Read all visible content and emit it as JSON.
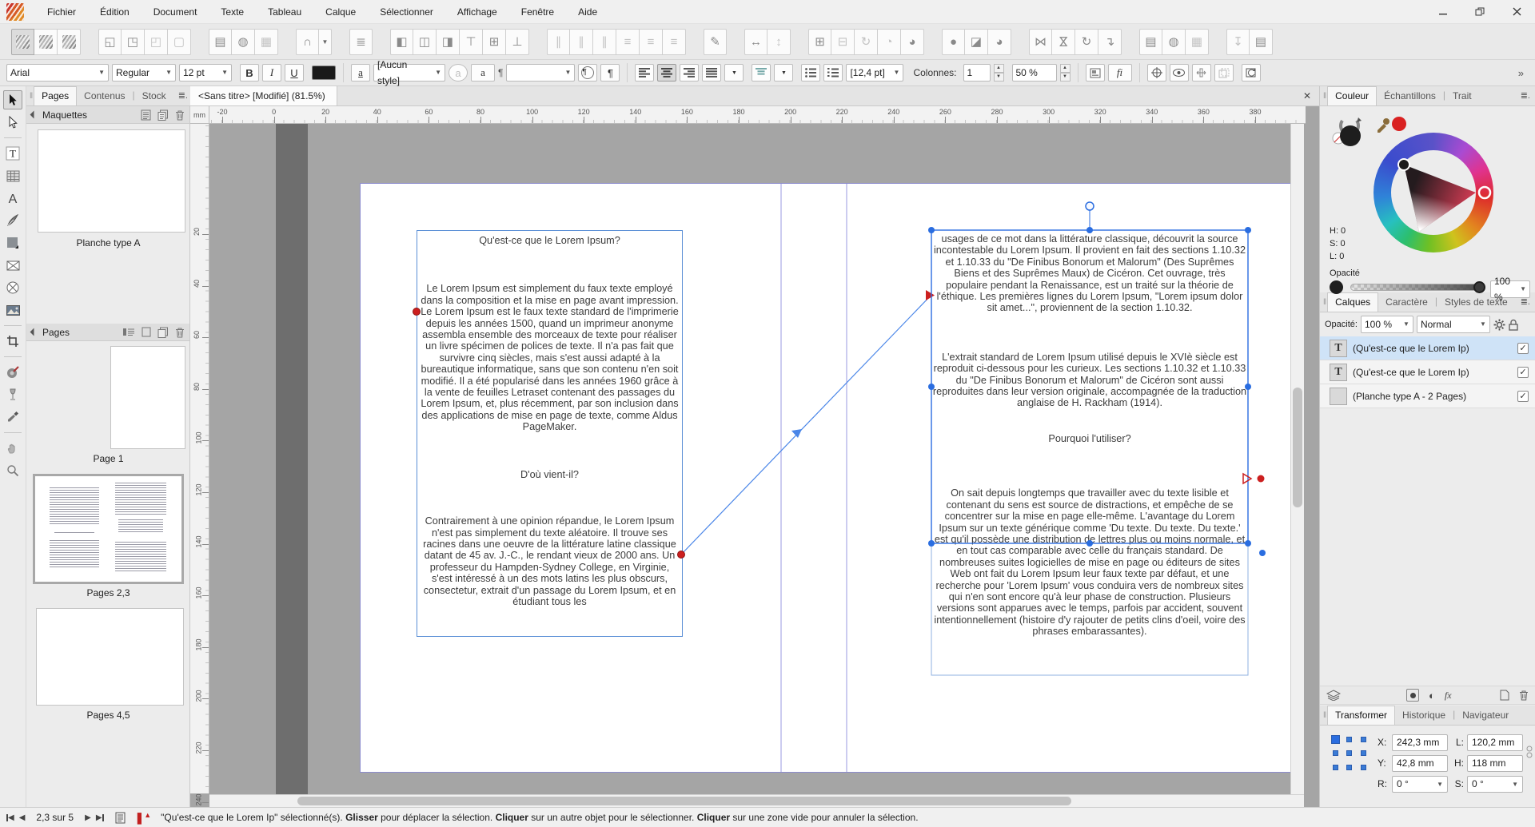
{
  "menubar": {
    "items": [
      "Fichier",
      "Édition",
      "Document",
      "Texte",
      "Tableau",
      "Calque",
      "Sélectionner",
      "Affichage",
      "Fenêtre",
      "Aide"
    ]
  },
  "window_controls": [
    "minimize",
    "restore",
    "close"
  ],
  "toolbar_main": {
    "groups": [
      {
        "icons": [
          "app-mode-design",
          "app-mode-layout",
          "app-mode-edit"
        ],
        "active": 0
      },
      {
        "icons": [
          "bring-to-front",
          "bring-forward",
          "send-backward",
          "send-to-back"
        ],
        "dim": [
          2,
          3
        ]
      },
      {
        "icons": [
          "text-flow-page",
          "text-flow-oval",
          "text-flow-off"
        ],
        "dim": [
          2
        ]
      },
      {
        "icons": [
          "snap-magnet",
          "snap-dropdown"
        ]
      },
      {
        "icons": [
          "text-columns"
        ]
      },
      {
        "icons": [
          "align-left-edges",
          "align-centers-horizontal",
          "align-right-edges",
          "align-top-edges",
          "align-centers-vertical",
          "align-bottom-edges"
        ]
      },
      {
        "icons": [
          "distribute-left",
          "distribute-center-h",
          "distribute-right",
          "distribute-top",
          "distribute-center-v",
          "distribute-bottom"
        ],
        "dim": [
          0,
          1,
          2,
          3,
          4,
          5
        ]
      },
      {
        "icons": [
          "lasso-select"
        ]
      },
      {
        "icons": [
          "space-horizontal",
          "space-vertical"
        ],
        "dim": [
          1
        ]
      },
      {
        "icons": [
          "page-add",
          "page-remove",
          "page-rotate",
          "page-half",
          "page-quarter"
        ],
        "dim": [
          1,
          2,
          3
        ]
      },
      {
        "icons": [
          "shape-oval",
          "shape-rect",
          "shape-pie"
        ]
      },
      {
        "icons": [
          "flip-horizontal",
          "flip-vertical",
          "rotate-object",
          "rotate-text"
        ]
      },
      {
        "icons": [
          "wrap-shape",
          "wrap-oval",
          "wrap-none"
        ],
        "dim": [
          2
        ]
      },
      {
        "icons": [
          "pin-object",
          "pin-text"
        ],
        "dim": [
          0
        ]
      }
    ]
  },
  "toolbar_text": {
    "font_family": "Arial",
    "font_style": "Regular",
    "font_size": "12 pt",
    "bold_label": "B",
    "italic_label": "I",
    "underline_label": "U",
    "char_color_label": "a",
    "char_style_value": "[Aucun style]",
    "circle_a_label": "a",
    "box_a_label": "a",
    "pilcrow": "¶",
    "para_style_value": "",
    "leading_value": "[12,4 pt]",
    "columns_label": "Colonnes:",
    "columns_value": "1",
    "zoom_value": "50 %",
    "ligature_label": "fi",
    "overflow_chevron": "»"
  },
  "left_panel_tabs": {
    "tabs": [
      "Pages",
      "Contenus",
      "Stock"
    ],
    "active": "Pages"
  },
  "document_tab": {
    "title": "<Sans titre> [Modifié] (81.5%)"
  },
  "tools": [
    "select-arrow",
    "direct-select-arrow",
    "|",
    "text-tool",
    "table-tool",
    "character-tool",
    "pen-tool",
    "rectangle-tool",
    "frame-x-tool",
    "frame-ellipse-tool",
    "image-tool",
    "|",
    "crop-tool",
    "|",
    "palette-tool",
    "glass-tool",
    "eyedropper-tool",
    "|",
    "hand-tool",
    "zoom-tool"
  ],
  "left_panel": {
    "maquettes_title": "Maquettes",
    "maquette_label": "Planche type A",
    "pages_title": "Pages",
    "page_items": [
      {
        "label": "Page 1",
        "kind": "portrait",
        "selected": false
      },
      {
        "label": "Pages 2,3",
        "kind": "spread",
        "selected": true
      },
      {
        "label": "Pages 4,5",
        "kind": "landscape",
        "selected": false
      }
    ]
  },
  "ruler": {
    "unit": "mm",
    "h_ticks": [
      -20,
      0,
      20,
      40,
      60,
      80,
      100,
      120,
      140,
      160,
      180,
      200,
      220,
      240,
      260,
      280,
      300,
      320,
      340,
      360,
      380
    ],
    "v_ticks": [
      20,
      40,
      60,
      80,
      100,
      120,
      140,
      160,
      180,
      200,
      220,
      240
    ]
  },
  "canvas": {
    "left_frame": {
      "heading1": "Qu'est-ce que le Lorem Ipsum?",
      "para1": "Le Lorem Ipsum est simplement du faux texte employé dans la composition et la mise en page avant impression. Le Lorem Ipsum est le faux texte standard de l'imprimerie depuis les années 1500, quand un imprimeur anonyme assembla ensemble des morceaux de texte pour réaliser un livre spécimen de polices de texte. Il n'a pas fait que survivre cinq siècles, mais s'est aussi adapté à la bureautique informatique, sans que son contenu n'en soit modifié. Il a été popularisé dans les années 1960 grâce à la vente de feuilles Letraset contenant des passages du Lorem Ipsum, et, plus récemment, par son inclusion dans des applications de mise en page de texte, comme Aldus PageMaker.",
      "heading2": "D'où vient-il?",
      "para2": "Contrairement à une opinion répandue, le Lorem Ipsum n'est pas simplement du texte aléatoire. Il trouve ses racines dans une oeuvre de la littérature latine classique datant de 45 av. J.-C., le rendant vieux de 2000 ans. Un professeur du Hampden-Sydney College, en Virginie, s'est intéressé à un des mots latins les plus obscurs, consectetur, extrait d'un passage du Lorem Ipsum, et en étudiant tous les"
    },
    "right_frame": {
      "para1": "usages de ce mot dans la littérature classique, découvrit la source incontestable du Lorem Ipsum. Il provient en fait des sections 1.10.32 et 1.10.33 du \"De Finibus Bonorum et Malorum\" (Des Suprêmes Biens et des Suprêmes Maux) de Cicéron. Cet ouvrage, très populaire pendant la Renaissance, est un traité sur la théorie de l'éthique. Les premières lignes du Lorem Ipsum, \"Lorem ipsum dolor sit amet...\", proviennent de la section 1.10.32.",
      "para2": "L'extrait standard de Lorem Ipsum utilisé depuis le XVIè siècle est reproduit ci-dessous pour les curieux. Les sections 1.10.32 et 1.10.33 du \"De Finibus Bonorum et Malorum\" de Cicéron sont aussi reproduites dans leur version originale, accompagnée de la traduction anglaise de H. Rackham (1914).",
      "heading": "Pourquoi l'utiliser?",
      "para3": "On sait depuis longtemps que travailler avec du texte lisible et contenant du sens est source de distractions, et empêche de se concentrer sur la mise en page elle-même. L'avantage du Lorem Ipsum sur un texte générique comme 'Du texte. Du texte. Du texte.' est qu'il possède une distribution de lettres plus ou moins normale, et en tout cas comparable avec celle du français standard. De nombreuses suites logicielles de mise en page ou éditeurs de sites Web ont fait du Lorem Ipsum leur faux texte par défaut, et une recherche pour 'Lorem Ipsum' vous conduira vers de nombreux sites qui n'en sont encore qu'à leur phase de construction. Plusieurs versions sont apparues avec le temps, parfois par accident, souvent intentionnellement (histoire d'y rajouter de petits clins d'oeil, voire des phrases embarassantes)."
    }
  },
  "right_panel": {
    "color": {
      "tabs": [
        "Couleur",
        "Échantillons",
        "Trait"
      ],
      "active": "Couleur",
      "hsl_labels": [
        "H: 0",
        "S: 0",
        "L: 0"
      ],
      "opacity_label": "Opacité",
      "opacity_value": "100 %",
      "current_color": "#1e1e1e",
      "picker_color": "#d92121"
    },
    "layers": {
      "tabs": [
        "Calques",
        "Caractère",
        "Styles de texte"
      ],
      "active": "Calques",
      "opacity_label": "Opacité:",
      "opacity_value": "100 %",
      "blend_mode": "Normal",
      "rows": [
        {
          "icon": "T",
          "label": "(Qu'est-ce que le Lorem Ip)",
          "selected": true,
          "checked": true
        },
        {
          "icon": "T",
          "label": "(Qu'est-ce que le Lorem Ip)",
          "selected": false,
          "checked": true
        },
        {
          "icon": "",
          "label": "(Planche type A - 2 Pages)",
          "selected": false,
          "checked": true
        }
      ],
      "fx_label": "fx"
    },
    "transform": {
      "tabs": [
        "Transformer",
        "Historique",
        "Navigateur"
      ],
      "active": "Transformer",
      "x_label": "X:",
      "x_value": "242,3 mm",
      "y_label": "Y:",
      "y_value": "42,8 mm",
      "w_label": "L:",
      "w_value": "120,2 mm",
      "h_label": "H:",
      "h_value": "118 mm",
      "r_label": "R:",
      "r_value": "0 °",
      "s_label": "S:",
      "s_value": "0 °"
    }
  },
  "statusbar": {
    "page_nav": "2,3 sur 5",
    "message": [
      {
        "text": "\"Qu'est-ce que le Lorem Ip\" sélectionné(s). ",
        "bold": false
      },
      {
        "text": "Glisser",
        "bold": true
      },
      {
        "text": " pour déplacer la sélection. ",
        "bold": false
      },
      {
        "text": "Cliquer",
        "bold": true
      },
      {
        "text": " sur un autre objet pour le sélectionner. ",
        "bold": false
      },
      {
        "text": "Cliquer",
        "bold": true
      },
      {
        "text": " sur une zone vide pour annuler la sélection.",
        "bold": false
      }
    ]
  },
  "accent_colors": {
    "selection_blue": "#2a6de0",
    "frame_blue": "#5b8fd6",
    "guide_purple": "#9a9ae0",
    "marker_red": "#cc1f1f"
  }
}
